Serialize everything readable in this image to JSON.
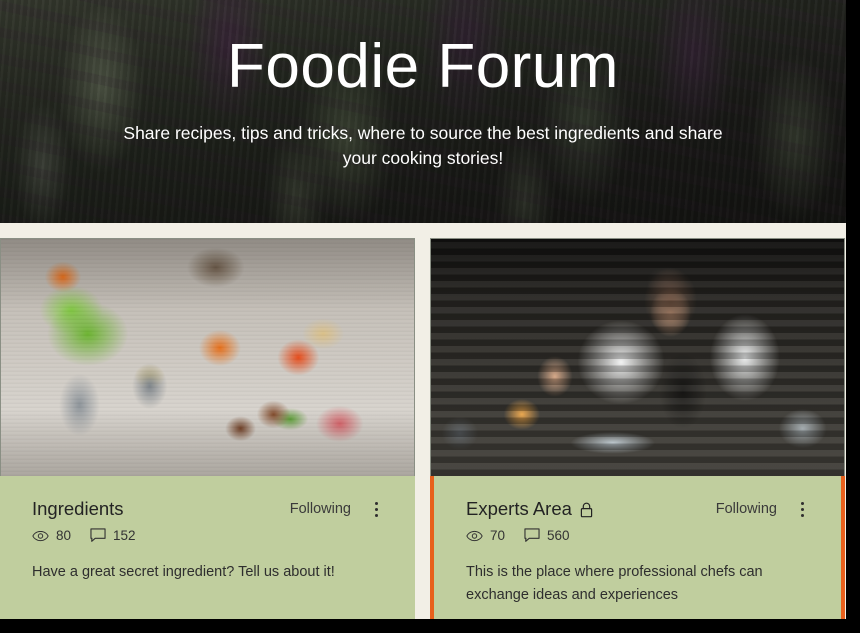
{
  "hero": {
    "title": "Foodie Forum",
    "subtitle": "Share recipes, tips and tricks, where to source the best ingredients and share your cooking stories!"
  },
  "colors": {
    "page_background": "#f2efe6",
    "card_background": "#c0ce9e",
    "highlight_outline": "#e8601c",
    "hero_text": "#ffffff",
    "body_text": "#2e2e2e"
  },
  "cards": [
    {
      "title": "Ingredients",
      "locked": false,
      "lock_icon": "",
      "follow_label": "Following",
      "menu_icon": "kebab-menu-icon",
      "views_icon": "eye-icon",
      "views": "80",
      "comments_icon": "comment-bubble-icon",
      "comments": "152",
      "description": "Have a great secret ingredient? Tell us about it!",
      "image_alt": "Kitchen counter with basil plant, onions, peppers, cucumbers and pomegranate"
    },
    {
      "title": "Experts Area",
      "locked": true,
      "lock_icon": "lock-icon",
      "follow_label": "Following",
      "menu_icon": "kebab-menu-icon",
      "views_icon": "eye-icon",
      "views": "70",
      "comments_icon": "comment-bubble-icon",
      "comments": "560",
      "description": "This is the place where professional chefs can exchange ideas and experiences",
      "image_alt": "Chef plating a dish with tweezers in a restaurant kitchen"
    }
  ]
}
